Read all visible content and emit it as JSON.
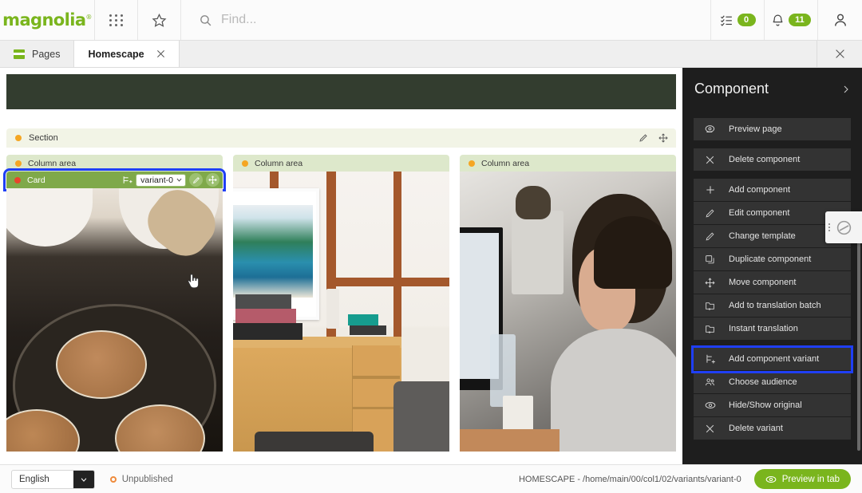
{
  "topbar": {
    "logo_text": "magnolia",
    "logo_tm": "®",
    "apps_icon": "grid-apps-icon",
    "favorites_icon": "star-icon",
    "search_placeholder": "Find...",
    "search_value": "",
    "tasks_icon": "tasks-icon",
    "tasks_badge": "0",
    "notifications_icon": "bell-icon",
    "notifications_badge": "11",
    "user_icon": "user-avatar-icon"
  },
  "tabbar": {
    "tabs": [
      {
        "label": "Pages",
        "icon": "pages-icon",
        "active": false,
        "closable": false
      },
      {
        "label": "Homescape",
        "icon": "",
        "active": true,
        "closable": true
      }
    ],
    "close_all_label": "×"
  },
  "canvas": {
    "section": {
      "label": "Section",
      "status_color": "#f5a623",
      "edit_icon": "pencil-icon",
      "move_icon": "move-icon"
    },
    "columns": [
      {
        "label": "Column area",
        "status_color": "#f5a623",
        "card": {
          "label": "Card",
          "status_color": "#e8462c",
          "variant_icon": "variant-icon",
          "variant_value": "variant-0",
          "variant_options": [
            "variant-0"
          ],
          "edit_icon": "pencil-icon",
          "move_icon": "move-icon",
          "highlighted": true
        },
        "image_alt": "pancakes cooking in a pan"
      },
      {
        "label": "Column area",
        "status_color": "#f5a623",
        "card": null,
        "image_alt": "living room interior with framed artwork and wooden cabinet"
      },
      {
        "label": "Column area",
        "status_color": "#f5a623",
        "card": null,
        "image_alt": "man working at a computer in an office"
      }
    ],
    "hero_color": "#333d2f"
  },
  "panel": {
    "title": "Component",
    "collapse_icon": "chevron-right-icon",
    "groups": [
      {
        "items": [
          {
            "label": "Preview page",
            "icon": "preview-icon",
            "highlighted": false
          }
        ]
      },
      {
        "items": [
          {
            "label": "Delete component",
            "icon": "close-icon",
            "highlighted": false
          }
        ]
      },
      {
        "items": [
          {
            "label": "Add component",
            "icon": "plus-icon",
            "highlighted": false
          },
          {
            "label": "Edit component",
            "icon": "pencil-icon",
            "highlighted": false
          },
          {
            "label": "Change template",
            "icon": "pencil-icon",
            "highlighted": false
          },
          {
            "label": "Duplicate component",
            "icon": "duplicate-icon",
            "highlighted": false
          },
          {
            "label": "Move component",
            "icon": "move-icon",
            "highlighted": false
          },
          {
            "label": "Add to translation batch",
            "icon": "folder-plus-icon",
            "highlighted": false
          },
          {
            "label": "Instant translation",
            "icon": "folder-plus-icon",
            "highlighted": false
          }
        ]
      },
      {
        "items": [
          {
            "label": "Add component variant",
            "icon": "variant-add-icon",
            "highlighted": true
          },
          {
            "label": "Choose audience",
            "icon": "audience-icon",
            "highlighted": false
          },
          {
            "label": "Hide/Show original",
            "icon": "eye-icon",
            "highlighted": false
          },
          {
            "label": "Delete variant",
            "icon": "close-icon",
            "highlighted": false
          }
        ]
      }
    ],
    "flyout_icon": "blocked-icon"
  },
  "bottombar": {
    "language_value": "English",
    "language_options": [
      "English"
    ],
    "language_chevron": "chevron-down-icon",
    "status_label": "Unpublished",
    "status_color": "#ef8b3c",
    "path": "HOMESCAPE - /home/main/00/col1/02/variants/variant-0",
    "preview_label": "Preview in tab",
    "preview_icon": "eye-icon",
    "preview_color": "#7ab51d"
  },
  "accent": {
    "brand_green": "#7ab51d",
    "highlight_blue": "#1f3ff5",
    "card_green": "#7fa94a"
  }
}
